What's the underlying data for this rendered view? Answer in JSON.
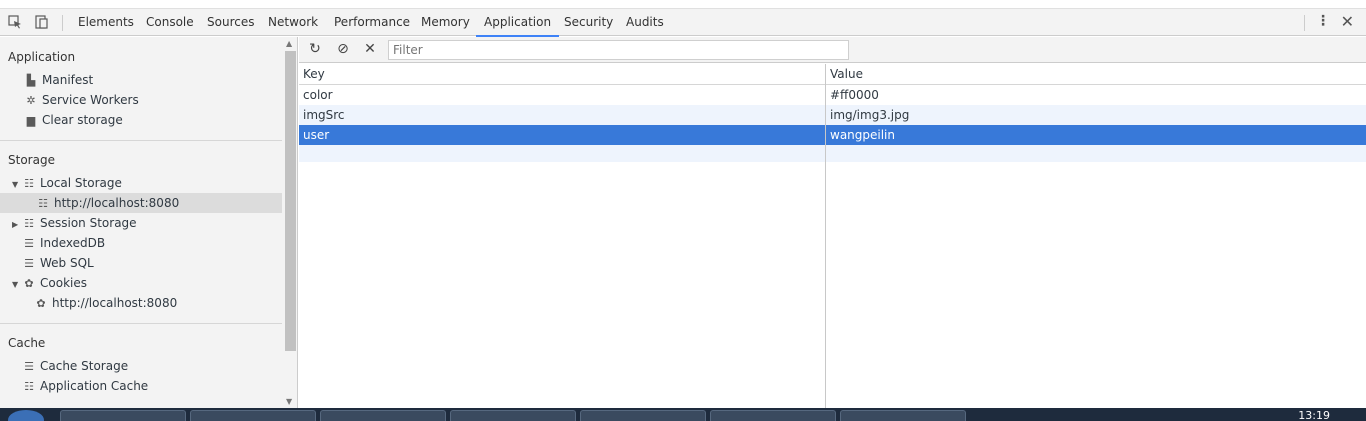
{
  "toolbar": {
    "tabs": [
      "Elements",
      "Console",
      "Sources",
      "Network",
      "Performance",
      "Memory",
      "Application",
      "Security",
      "Audits"
    ],
    "active_tab": "Application"
  },
  "sidebar": {
    "application": {
      "title": "Application",
      "items": [
        "Manifest",
        "Service Workers",
        "Clear storage"
      ]
    },
    "storage": {
      "title": "Storage",
      "local_storage": "Local Storage",
      "local_storage_origin": "http://localhost:8080",
      "session_storage": "Session Storage",
      "indexeddb": "IndexedDB",
      "websql": "Web SQL",
      "cookies": "Cookies",
      "cookies_origin": "http://localhost:8080"
    },
    "cache": {
      "title": "Cache",
      "cache_storage": "Cache Storage",
      "application_cache": "Application Cache"
    }
  },
  "filter": {
    "placeholder": "Filter"
  },
  "table": {
    "headers": {
      "key": "Key",
      "value": "Value"
    },
    "rows": [
      {
        "key": "color",
        "value": "#ff0000"
      },
      {
        "key": "imgSrc",
        "value": "img/img3.jpg"
      },
      {
        "key": "user",
        "value": "wangpeilin"
      }
    ],
    "selected_row": 2
  },
  "taskbar": {
    "clock": "13:19"
  },
  "colors": {
    "accent": "#3e82f7",
    "selection": "#3879d9"
  }
}
